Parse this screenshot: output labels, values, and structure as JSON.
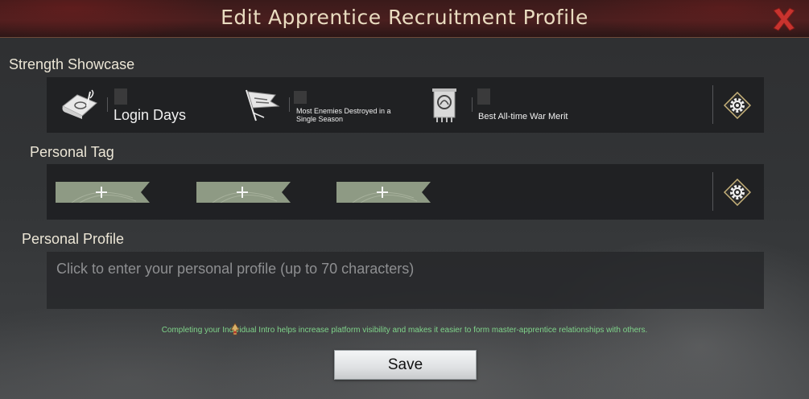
{
  "dialog": {
    "title": "Edit Apprentice Recruitment Profile"
  },
  "strength_showcase": {
    "label": "Strength Showcase",
    "stats": [
      {
        "label": "Login Days",
        "icon": "scroll-quill-icon"
      },
      {
        "label": "Most Enemies Destroyed in a Single Season",
        "icon": "war-flag-icon"
      },
      {
        "label": "Best All-time War Merit",
        "icon": "banner-emblem-icon"
      }
    ]
  },
  "personal_tag": {
    "label": "Personal Tag",
    "slots": 3
  },
  "personal_profile": {
    "label": "Personal Profile",
    "placeholder": "Click to enter your personal profile (up to 70 characters)",
    "value": ""
  },
  "hint_text": "Completing your Individual Intro helps increase platform visibility and makes it easier to form master-apprentice relationships with others.",
  "save_label": "Save",
  "colors": {
    "title_text": "#e9dcc0",
    "hint_text": "#7fd48a",
    "close_x": "#c8332e",
    "tag_green": "#8e9a84"
  }
}
